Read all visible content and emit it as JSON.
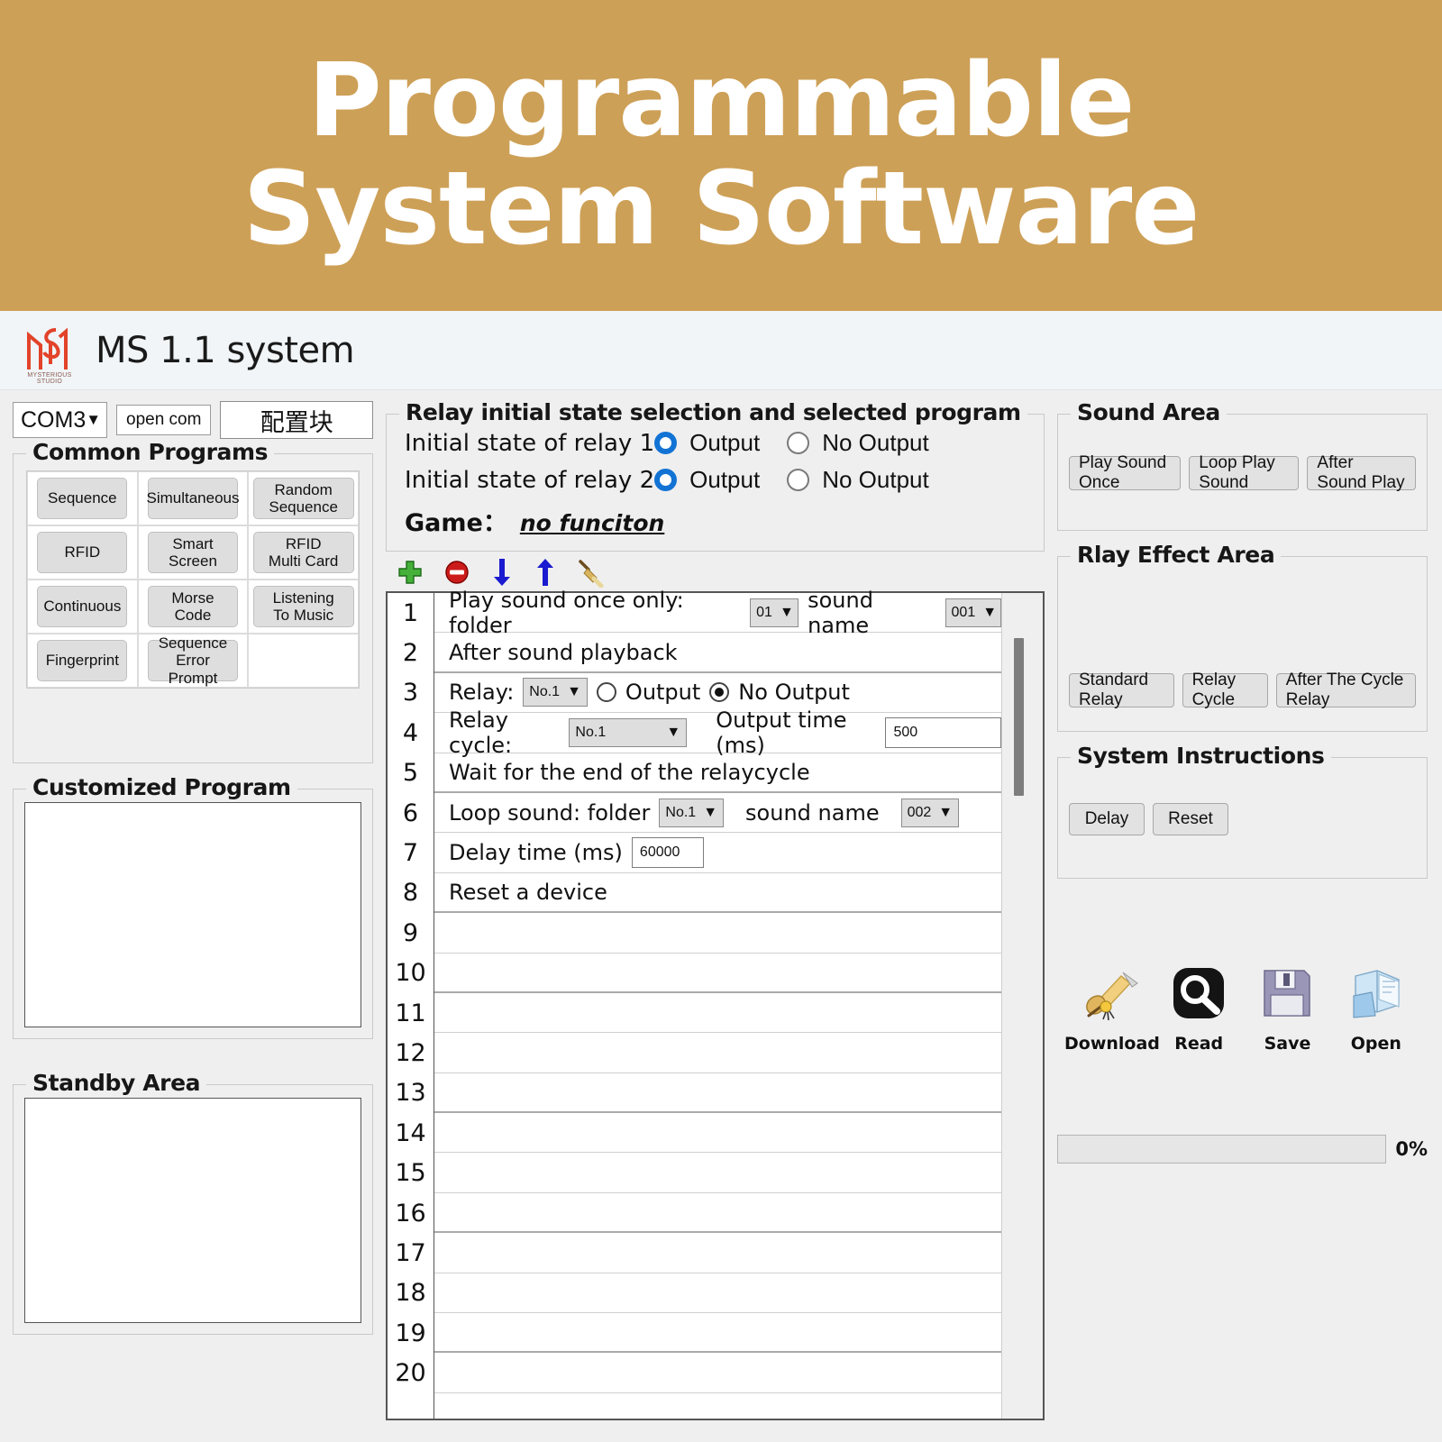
{
  "banner": {
    "line1": "Programmable",
    "line2": "System Software",
    "bg": "#cda057"
  },
  "titlebar": {
    "app_title": "MS 1.1 system",
    "logo_caption": "MYSTERIOUS STUDIO"
  },
  "toolbar": {
    "com_port": "COM3",
    "open_com_label": "open com",
    "config_label": "配置块",
    "caret": "▼"
  },
  "common_programs": {
    "legend": "Common Programs",
    "buttons": [
      "Sequence",
      "Simultaneous",
      "Random\nSequence",
      "RFID",
      "Smart\nScreen",
      "RFID\nMulti Card",
      "Continuous",
      "Morse Code",
      "Listening\nTo Music",
      "Fingerprint",
      "Sequence\nError Prompt",
      ""
    ]
  },
  "customized_program": {
    "legend": "Customized Program",
    "content": ""
  },
  "standby_area": {
    "legend": "Standby Area",
    "content": ""
  },
  "relay_state": {
    "legend": "Relay initial state selection and selected program",
    "relay1_label": "Initial state of relay 1",
    "relay2_label": "Initial state of relay 2",
    "output_label": "Output",
    "no_output_label": "No Output",
    "relay1_selected": "Output",
    "relay2_selected": "Output",
    "game_label": "Game：",
    "game_value": "no funciton"
  },
  "list_toolbar": {
    "icons": [
      "add-icon",
      "remove-icon",
      "move-down-icon",
      "move-up-icon",
      "clear-icon"
    ]
  },
  "program_list": {
    "row_numbers": [
      "1",
      "2",
      "3",
      "4",
      "5",
      "6",
      "7",
      "8",
      "9",
      "10",
      "11",
      "12",
      "13",
      "14",
      "15",
      "16",
      "17",
      "18",
      "19",
      "20"
    ],
    "rows": [
      {
        "n": "1",
        "type": "play_once",
        "text": "Play sound once only: folder",
        "folder": "01",
        "sound_name_label": "sound name",
        "sound_name": "001"
      },
      {
        "n": "2",
        "type": "text",
        "text": "After sound playback"
      },
      {
        "n": "3",
        "type": "relay",
        "text": "Relay:",
        "relay": "No.1",
        "output_label": "Output",
        "no_output_label": "No Output",
        "selected": "No Output"
      },
      {
        "n": "4",
        "type": "relay_cycle",
        "text": "Relay cycle:",
        "cycle": "No.1",
        "output_time_label": "Output time (ms)",
        "output_time": "500"
      },
      {
        "n": "5",
        "type": "text",
        "text": "Wait for the end of the relaycycle"
      },
      {
        "n": "6",
        "type": "loop_sound",
        "text": "Loop sound: folder",
        "folder": "No.1",
        "sound_name_label": "sound name",
        "sound_name": "002"
      },
      {
        "n": "7",
        "type": "delay",
        "text": "Delay time (ms)",
        "delay": "60000"
      },
      {
        "n": "8",
        "type": "text",
        "text": "Reset a device"
      },
      {
        "n": "9",
        "type": "empty",
        "text": ""
      },
      {
        "n": "10",
        "type": "empty",
        "text": ""
      },
      {
        "n": "11",
        "type": "empty",
        "text": ""
      },
      {
        "n": "12",
        "type": "empty",
        "text": ""
      },
      {
        "n": "13",
        "type": "empty",
        "text": ""
      },
      {
        "n": "14",
        "type": "empty",
        "text": ""
      },
      {
        "n": "15",
        "type": "empty",
        "text": ""
      },
      {
        "n": "16",
        "type": "empty",
        "text": ""
      },
      {
        "n": "17",
        "type": "empty",
        "text": ""
      },
      {
        "n": "18",
        "type": "empty",
        "text": ""
      },
      {
        "n": "19",
        "type": "empty",
        "text": ""
      },
      {
        "n": "20",
        "type": "empty",
        "text": ""
      }
    ]
  },
  "sound_area": {
    "legend": "Sound Area",
    "buttons": [
      "Play Sound Once",
      "Loop Play Sound",
      "After Sound Play"
    ]
  },
  "relay_effect_area": {
    "legend": "Rlay Effect Area",
    "buttons": [
      "Standard Relay",
      "Relay Cycle",
      "After The Cycle Relay"
    ]
  },
  "system_instructions": {
    "legend": "System Instructions",
    "buttons": [
      "Delay",
      "Reset"
    ]
  },
  "action_icons": [
    {
      "icon": "download-scroll-icon",
      "label": "Download"
    },
    {
      "icon": "magnifier-read-icon",
      "label": "Read"
    },
    {
      "icon": "floppy-save-icon",
      "label": "Save"
    },
    {
      "icon": "open-folder-icon",
      "label": "Open"
    }
  ],
  "progress": {
    "percent_label": "0%",
    "value": 0
  },
  "colors": {
    "accent_blue": "#1273d4",
    "banner": "#cda057",
    "logo_red": "#e2432a"
  }
}
